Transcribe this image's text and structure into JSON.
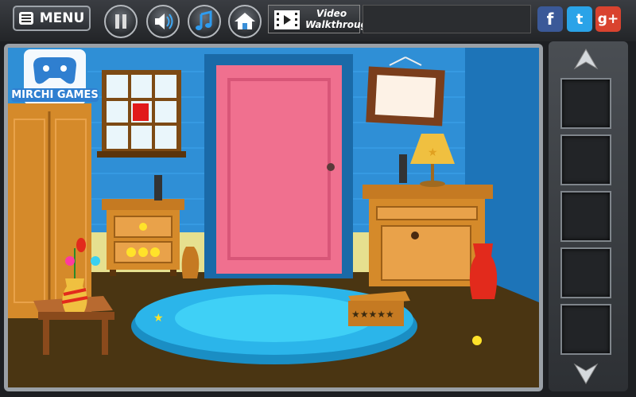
{
  "toolbar": {
    "menu_label": "MENU",
    "video_line1": "Video",
    "video_line2": "Walkthrough"
  },
  "social": {
    "facebook": "f",
    "twitter": "t",
    "googleplus": "g+"
  },
  "logo": {
    "text": "MIRCHI GAMES"
  },
  "scene": {
    "crate_stars": "★★★★★"
  },
  "colors": {
    "wall": "#2f8fd6",
    "floor": "#4a3512",
    "door": "#f0708f",
    "rug": "#2bb5ea",
    "wood": "#d58a2a"
  },
  "icons": [
    "hamburger-icon",
    "pause-icon",
    "speaker-icon",
    "music-note-icon",
    "home-icon",
    "film-icon",
    "facebook-icon",
    "twitter-icon",
    "googleplus-icon",
    "up-arrow-icon",
    "down-arrow-icon"
  ]
}
